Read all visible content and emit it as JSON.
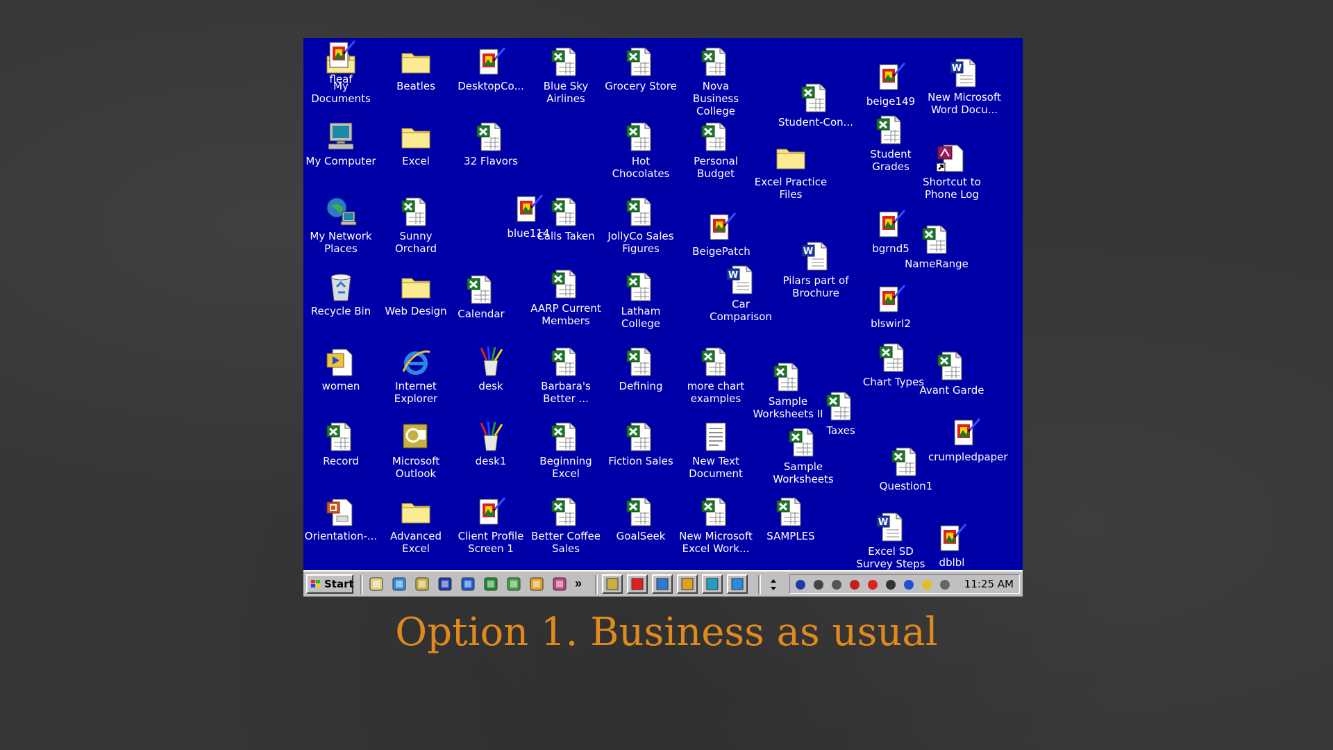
{
  "desktop": {
    "background_color": "#0000a8",
    "icons": [
      {
        "label": "My Documents",
        "icon": "my-documents-icon"
      },
      {
        "label": "Beatles",
        "icon": "folder-icon"
      },
      {
        "label": "DesktopCo...",
        "icon": "paint-image-icon"
      },
      {
        "label": "Blue Sky Airlines",
        "icon": "excel-file-icon"
      },
      {
        "label": "Grocery Store",
        "icon": "excel-file-icon"
      },
      {
        "label": "Nova Business College",
        "icon": "excel-file-icon"
      },
      {
        "label": "Student-Con...",
        "icon": "excel-file-icon"
      },
      {
        "label": "beige149",
        "icon": "paint-image-icon"
      },
      {
        "label": "New Microsoft Word Docu...",
        "icon": "word-file-icon"
      },
      {
        "label": "My Computer",
        "icon": "my-computer-icon"
      },
      {
        "label": "Excel",
        "icon": "folder-icon"
      },
      {
        "label": "32 Flavors",
        "icon": "excel-file-icon"
      },
      {
        "label": "Hot Chocolates",
        "icon": "excel-file-icon"
      },
      {
        "label": "Personal Budget",
        "icon": "excel-file-icon"
      },
      {
        "label": "Excel Practice Files",
        "icon": "folder-icon"
      },
      {
        "label": "Student Grades",
        "icon": "excel-file-icon"
      },
      {
        "label": "Shortcut to Phone Log",
        "icon": "access-shortcut-icon"
      },
      {
        "label": "My Network Places",
        "icon": "network-places-icon"
      },
      {
        "label": "Sunny Orchard",
        "icon": "excel-file-icon"
      },
      {
        "label": "blue114",
        "icon": "paint-image-icon"
      },
      {
        "label": "Calls Taken",
        "icon": "excel-file-icon"
      },
      {
        "label": "JollyCo Sales Figures",
        "icon": "excel-file-icon"
      },
      {
        "label": "BeigePatch",
        "icon": "paint-image-icon"
      },
      {
        "label": "bgrnd5",
        "icon": "paint-image-icon"
      },
      {
        "label": "NameRange",
        "icon": "excel-file-icon"
      },
      {
        "label": "Recycle Bin",
        "icon": "recycle-bin-icon"
      },
      {
        "label": "Web Design",
        "icon": "folder-icon"
      },
      {
        "label": "Calendar",
        "icon": "excel-file-icon"
      },
      {
        "label": "AARP Current Members",
        "icon": "excel-file-icon"
      },
      {
        "label": "Latham College",
        "icon": "excel-file-icon"
      },
      {
        "label": "Car Comparison",
        "icon": "word-file-icon"
      },
      {
        "label": "Pilars part of Brochure",
        "icon": "word-file-icon"
      },
      {
        "label": "blswirl2",
        "icon": "paint-image-icon"
      },
      {
        "label": "women",
        "icon": "video-file-icon"
      },
      {
        "label": "Internet Explorer",
        "icon": "internet-explorer-icon"
      },
      {
        "label": "desk",
        "icon": "pencil-cup-icon"
      },
      {
        "label": "Barbara's Better ...",
        "icon": "excel-file-icon"
      },
      {
        "label": "Defining",
        "icon": "excel-file-icon"
      },
      {
        "label": "more chart examples",
        "icon": "excel-file-icon"
      },
      {
        "label": "Sample Worksheets II",
        "icon": "excel-file-icon"
      },
      {
        "label": "Chart Types",
        "icon": "excel-file-icon"
      },
      {
        "label": "Avant Garde",
        "icon": "excel-file-icon"
      },
      {
        "label": "Taxes",
        "icon": "excel-file-icon"
      },
      {
        "label": "Record",
        "icon": "excel-file-icon"
      },
      {
        "label": "Microsoft Outlook",
        "icon": "outlook-icon"
      },
      {
        "label": "desk1",
        "icon": "pencil-cup-icon"
      },
      {
        "label": "Beginning Excel",
        "icon": "excel-file-icon"
      },
      {
        "label": "Fiction Sales",
        "icon": "excel-file-icon"
      },
      {
        "label": "New Text Document",
        "icon": "text-file-icon"
      },
      {
        "label": "Sample Worksheets",
        "icon": "excel-file-icon"
      },
      {
        "label": "crumpledpaper",
        "icon": "paint-image-icon"
      },
      {
        "label": "Question1",
        "icon": "excel-file-icon"
      },
      {
        "label": "Orientation-...",
        "icon": "powerpoint-file-icon"
      },
      {
        "label": "Advanced Excel",
        "icon": "folder-icon"
      },
      {
        "label": "Client Profile Screen 1",
        "icon": "paint-image-icon"
      },
      {
        "label": "Better Coffee Sales",
        "icon": "excel-file-icon"
      },
      {
        "label": "GoalSeek",
        "icon": "excel-file-icon"
      },
      {
        "label": "New Microsoft Excel Work...",
        "icon": "excel-file-icon"
      },
      {
        "label": "SAMPLES",
        "icon": "excel-file-icon"
      },
      {
        "label": "Excel SD Survey Steps",
        "icon": "word-file-icon"
      },
      {
        "label": "dblbl",
        "icon": "paint-image-icon"
      },
      {
        "label": "fleaf",
        "icon": "paint-image-icon"
      }
    ]
  },
  "taskbar": {
    "start_label": "Start",
    "clock": "11:25 AM",
    "quick_launch_icons": [
      "show-desktop-icon",
      "internet-explorer-icon",
      "outlook-icon",
      "word-icon",
      "visio-icon",
      "msn-icon",
      "paint-icon",
      "pencil-icon",
      "starburst-icon",
      "more-chevron-icon"
    ],
    "more_label": "»",
    "task_icons": [
      "outlook-task-icon",
      "paint-task-icon",
      "recycle-task-icon",
      "pencil-task-icon",
      "network-task-icon",
      "explorer-task-icon"
    ],
    "tray_icons": [
      "antivirus-icon",
      "magnifier-icon",
      "volume-icon",
      "display-icon",
      "link-icon",
      "cables-icon",
      "eye-icon",
      "smiley-icon",
      "mail-icon"
    ]
  },
  "caption": "Option 1. Business as usual",
  "colors": {
    "caption": "#e08a1e",
    "background": "#363636",
    "taskbar": "#c0c0c0"
  }
}
